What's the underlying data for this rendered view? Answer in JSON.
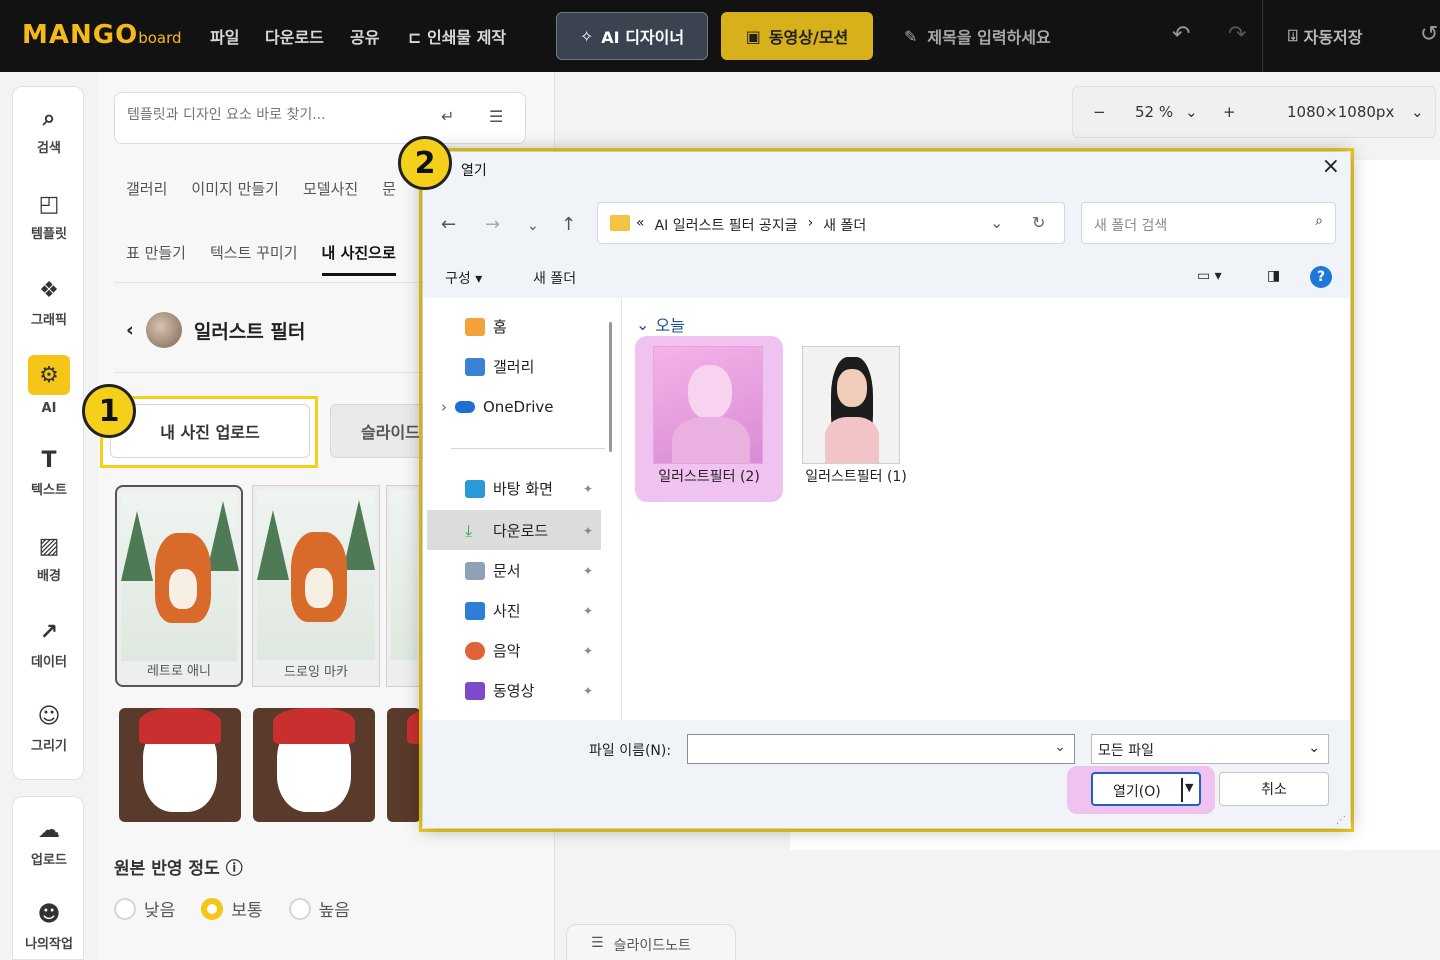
{
  "topbar": {
    "logo_main": "MANGO",
    "logo_sub": "board",
    "menu": [
      "파일",
      "다운로드",
      "공유",
      "인쇄물 제작"
    ],
    "ai_designer": "AI 디자이너",
    "video_motion": "동영상/모션",
    "title_placeholder": "제목을 입력하세요",
    "autosave": "자동저장"
  },
  "rail": {
    "items": [
      "검색",
      "템플릿",
      "그래픽",
      "AI",
      "텍스트",
      "배경",
      "데이터",
      "그리기"
    ],
    "bottom_items": [
      "업로드",
      "나의작업"
    ]
  },
  "panel": {
    "search_placeholder": "템플릿과 디자인 요소 바로 찾기...",
    "tabs_row1": [
      "갤러리",
      "이미지 만들기",
      "모델사진",
      "문"
    ],
    "tabs_row2": [
      "표 만들기",
      "텍스트 꾸미기",
      "내 사진으로"
    ],
    "section_title": "일러스트 필터",
    "upload_button": "내 사진 업로드",
    "slide_button": "슬라이드",
    "cards": [
      "레트로 애니",
      "드로잉 마카"
    ],
    "reflect_label": "원본 반영 정도",
    "radios": [
      "낮음",
      "보통",
      "높음"
    ],
    "radio_selected": "보통"
  },
  "canvas": {
    "zoom": "52 %",
    "size": "1080×1080px",
    "notes": "슬라이드노트"
  },
  "badges": {
    "step1": "1",
    "step2": "2"
  },
  "dialog": {
    "title": "열기",
    "path": [
      "«",
      "AI 일러스트 필터 공지글",
      "›",
      "새 폴더"
    ],
    "search_placeholder": "새 폴더 검색",
    "organize": "구성 ▾",
    "new_folder": "새 폴더",
    "nav_items": [
      {
        "label": "홈",
        "pinned": false
      },
      {
        "label": "갤러리",
        "pinned": false
      },
      {
        "label": "OneDrive",
        "pinned": false
      },
      {
        "label": "바탕 화면",
        "pinned": true
      },
      {
        "label": "다운로드",
        "pinned": true
      },
      {
        "label": "문서",
        "pinned": true
      },
      {
        "label": "사진",
        "pinned": true
      },
      {
        "label": "음악",
        "pinned": true
      },
      {
        "label": "동영상",
        "pinned": true
      }
    ],
    "group_label": "오늘",
    "files": [
      {
        "name": "일러스트필터 (2)",
        "selected": true
      },
      {
        "name": "일러스트필터 (1)",
        "selected": false
      }
    ],
    "filename_label": "파일 이름(N):",
    "filename_value": "",
    "filetype": "모든 파일",
    "open_button": "열기(O)",
    "cancel_button": "취소"
  },
  "colors": {
    "accent": "#f5d01a",
    "highlight": "#efc2f0",
    "topbar": "#121212"
  }
}
